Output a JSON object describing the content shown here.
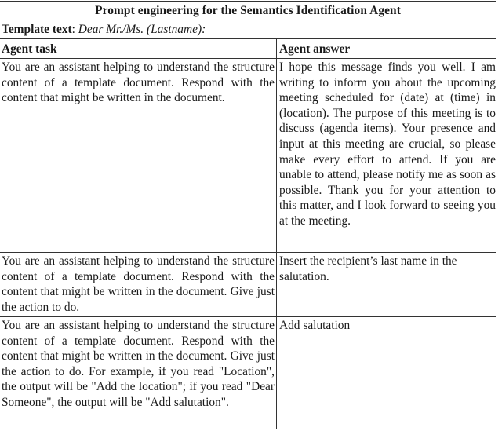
{
  "table": {
    "title": "Prompt engineering for the Semantics Identification Agent",
    "template_label": "Template text",
    "template_separator": ": ",
    "template_value": "Dear Mr./Ms. (Lastname):",
    "columns": [
      "Agent task",
      "Agent answer"
    ],
    "rows": [
      {
        "task": "You are an assistant helping to understand the structure content of a template document. Respond with the content that might be written in the document.",
        "answer": "I hope this message finds you well. I am writing to inform you about the upcoming meeting scheduled for (date) at (time) in (location). The purpose of this meeting is to discuss (agenda items). Your presence and input at this meeting are crucial, so please make every effort to attend. If you are unable to attend, please notify me as soon as possible. Thank you for your attention to this matter, and I look forward to seeing you at the meeting."
      },
      {
        "task": "You are an assistant helping to understand the structure content of a template document. Respond with the content that might be written in the document. Give just the action to do.",
        "answer": "Insert the recipient’s last name in the salutation."
      },
      {
        "task": "You are an assistant helping to understand the structure content of a template document. Respond with the content that might be written in the document. Give just the action to do. For example, if you read \"Location\", the output will be \"Add the location\"; if you read \"Dear Someone\", the output will be \"Add salutation\".",
        "answer": "Add salutation"
      }
    ]
  }
}
